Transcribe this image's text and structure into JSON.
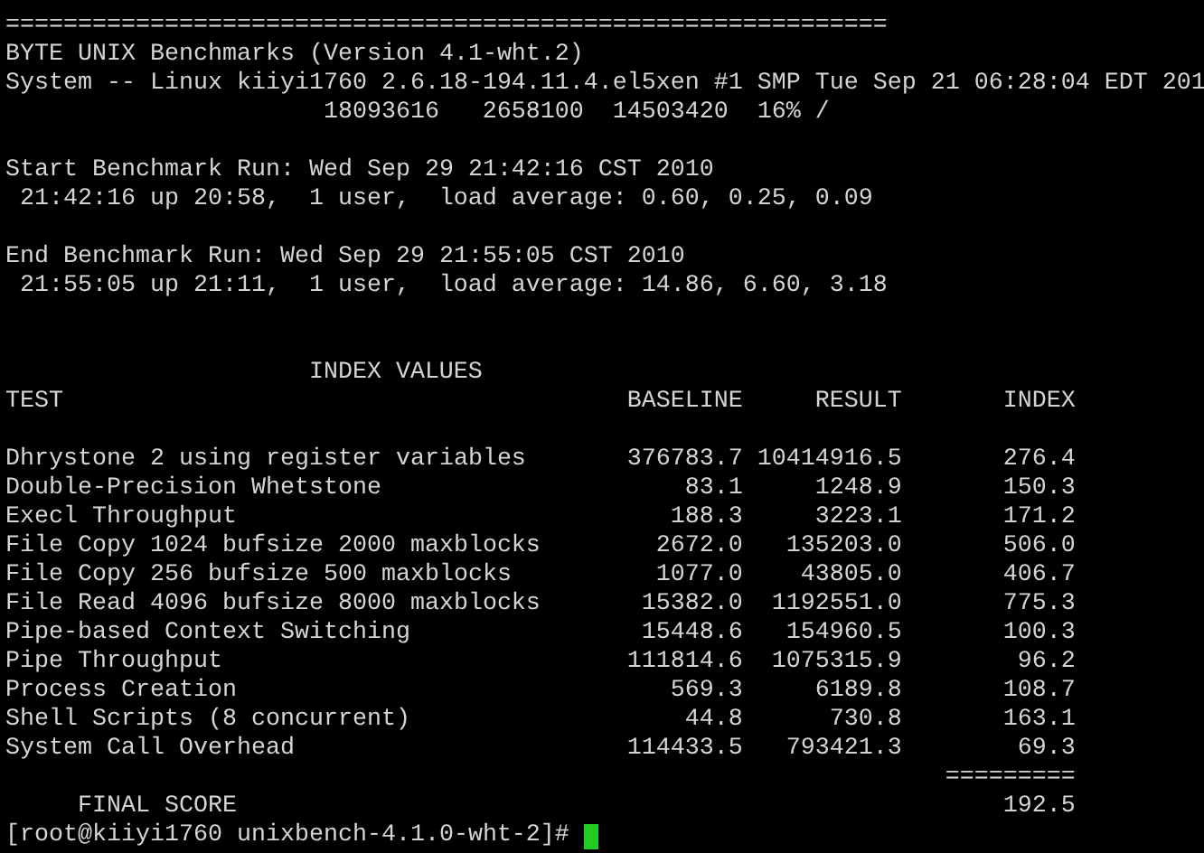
{
  "banner": {
    "rule": "=============================================================",
    "title": "BYTE UNIX Benchmarks (Version 4.1-wht.2)",
    "system": "System -- Linux kiiyi1760 2.6.18-194.11.4.el5xen #1 SMP Tue Sep 21 06:28:04 EDT 201",
    "disk": "18093616   2658100  14503420  16% /"
  },
  "runs": [
    {
      "line": "Start Benchmark Run: Wed Sep 29 21:42:16 CST 2010",
      "uptime": "21:42:16 up 20:58,  1 user,  load average: 0.60, 0.25, 0.09"
    },
    {
      "line": "End Benchmark Run: Wed Sep 29 21:55:05 CST 2010",
      "uptime": "21:55:05 up 21:11,  1 user,  load average: 14.86, 6.60, 3.18"
    }
  ],
  "index_values": {
    "title": "INDEX VALUES",
    "columns": [
      "TEST",
      "BASELINE",
      "RESULT",
      "INDEX"
    ],
    "rows": [
      [
        "Dhrystone 2 using register variables",
        "376783.7",
        "10414916.5",
        "276.4"
      ],
      [
        "Double-Precision Whetstone",
        "83.1",
        "1248.9",
        "150.3"
      ],
      [
        "Execl Throughput",
        "188.3",
        "3223.1",
        "171.2"
      ],
      [
        "File Copy 1024 bufsize 2000 maxblocks",
        "2672.0",
        "135203.0",
        "506.0"
      ],
      [
        "File Copy 256 bufsize 500 maxblocks",
        "1077.0",
        "43805.0",
        "406.7"
      ],
      [
        "File Read 4096 bufsize 8000 maxblocks",
        "15382.0",
        "1192551.0",
        "775.3"
      ],
      [
        "Pipe-based Context Switching",
        "15448.6",
        "154960.5",
        "100.3"
      ],
      [
        "Pipe Throughput",
        "111814.6",
        "1075315.9",
        "96.2"
      ],
      [
        "Process Creation",
        "569.3",
        "6189.8",
        "108.7"
      ],
      [
        "Shell Scripts (8 concurrent)",
        "44.8",
        "730.8",
        "163.1"
      ],
      [
        "System Call Overhead",
        "114433.5",
        "793421.3",
        "69.3"
      ]
    ],
    "rule": "=========",
    "final": {
      "label": "FINAL SCORE",
      "value": "192.5"
    }
  },
  "prompt": "[root@kiiyi1760 unixbench-4.1.0-wht-2]#"
}
